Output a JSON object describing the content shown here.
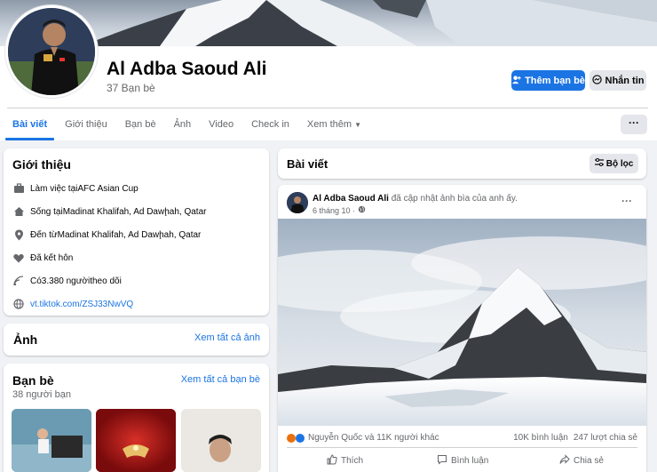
{
  "profile": {
    "name": "Al Adba Saoud Ali",
    "friends_count": "37 Bạn bè"
  },
  "buttons": {
    "add_friend": "Thêm bạn bè",
    "message": "Nhắn tin",
    "more": "···"
  },
  "tabs": [
    {
      "label": "Bài viết",
      "active": true
    },
    {
      "label": "Giới thiệu"
    },
    {
      "label": "Bạn bè"
    },
    {
      "label": "Ảnh"
    },
    {
      "label": "Video"
    },
    {
      "label": "Check in"
    },
    {
      "label": "Xem thêm"
    }
  ],
  "intro": {
    "title": "Giới thiệu",
    "work": {
      "prefix": "Làm việc tại ",
      "value": "AFC Asian Cup",
      "icon": "briefcase-icon"
    },
    "lives": {
      "prefix": "Sống tại ",
      "value": "Madinat Khalifah, Ad Dawḩah, Qatar",
      "icon": "home-icon"
    },
    "from": {
      "prefix": "Đến từ ",
      "value": "Madinat Khalifah, Ad Dawḩah, Qatar",
      "icon": "location-pin-icon"
    },
    "relationship": {
      "value": "Đã kết hôn",
      "icon": "heart-icon"
    },
    "followers": {
      "prefix": "Có ",
      "value": "3.380 người",
      "suffix": " theo dõi",
      "icon": "followers-icon"
    },
    "website": {
      "value": "vt.tiktok.com/ZSJ33NwVQ",
      "icon": "globe-icon"
    }
  },
  "photos": {
    "title": "Ảnh",
    "see_all": "Xem tất cả ảnh"
  },
  "friends": {
    "title": "Bạn bè",
    "count": "38 người bạn",
    "see_all": "Xem tất cả bạn bè"
  },
  "posts_header": {
    "title": "Bài viết",
    "filter": "Bộ lọc"
  },
  "post": {
    "author": "Al Adba Saoud Ali",
    "action": " đã cập nhật ảnh bìa của anh ấy.",
    "date": "6 tháng 10 ·",
    "reactions_text": "Nguyễn Quốc và 11K người khác",
    "comments": "10K bình luận",
    "shares": "247 lượt chia sẻ",
    "like": "Thích",
    "comment": "Bình luận",
    "share": "Chia sẻ"
  },
  "colors": {
    "accent": "#1b74e4",
    "background": "#f0f2f5",
    "secondary_text": "#65676b"
  }
}
